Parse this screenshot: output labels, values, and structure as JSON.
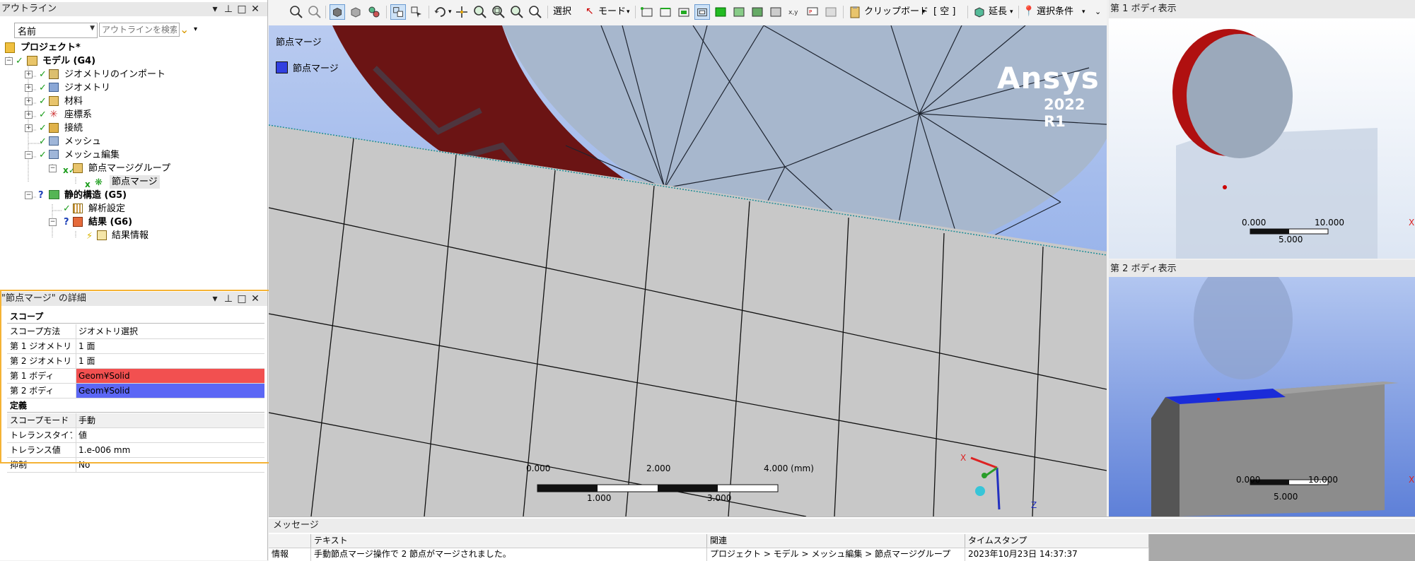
{
  "outline": {
    "title": "アウトライン",
    "filter_value": "名前",
    "search_placeholder": "アウトラインを検索",
    "tree": [
      {
        "label": "プロジェクト*",
        "bold": true
      },
      {
        "label": "モデル (G4)",
        "bold": true
      },
      {
        "label": "ジオメトリのインポート"
      },
      {
        "label": "ジオメトリ"
      },
      {
        "label": "材料"
      },
      {
        "label": "座標系"
      },
      {
        "label": "接続"
      },
      {
        "label": "メッシュ"
      },
      {
        "label": "メッシュ編集"
      },
      {
        "label": "節点マージグループ"
      },
      {
        "label": "節点マージ"
      },
      {
        "label": "静的構造 (G5)",
        "bold": true
      },
      {
        "label": "解析設定"
      },
      {
        "label": "結果 (G6)",
        "bold": true
      },
      {
        "label": "結果情報"
      }
    ]
  },
  "details": {
    "title": "\"節点マージ\" の詳細",
    "sections": {
      "scope": "スコープ",
      "definition": "定義"
    },
    "rows": [
      {
        "key": "スコープ方法",
        "value": "ジオメトリ選択"
      },
      {
        "key": "第 1 ジオメトリ",
        "value": "1 面"
      },
      {
        "key": "第 2 ジオメトリ",
        "value": "1 面"
      },
      {
        "key": "第 1 ボディ",
        "value": "Geom¥Solid"
      },
      {
        "key": "第 2 ボディ",
        "value": "Geom¥Solid"
      },
      {
        "key": "スコープモード",
        "value": "手動"
      },
      {
        "key": "トレランスタイプ",
        "value": "値"
      },
      {
        "key": "トレランス値",
        "value": "1.e-006 mm"
      },
      {
        "key": "抑制",
        "value": "No"
      }
    ],
    "colors": {
      "body1": "#f25050",
      "body2": "#5c67f5",
      "highlight_border": "#f5b335"
    }
  },
  "toolbar": {
    "select": "選択",
    "mode": "モード",
    "clipboard": "クリップボード",
    "empty": "[ 空 ]",
    "extend": "延長",
    "select_conditions": "選択条件"
  },
  "viewport": {
    "label": "節点マージ",
    "legend": "節点マージ",
    "brand": "Ansys",
    "version": "2022 R1",
    "scale_top": [
      "0.000",
      "2.000",
      "4.000 (mm)"
    ],
    "scale_bottom": [
      "1.000",
      "3.000"
    ],
    "axes": {
      "x": "X",
      "z": "Z"
    }
  },
  "body1_view": {
    "title": "第 1 ボディ表示",
    "scale_top": [
      "0.000",
      "10.000"
    ],
    "scale_bottom": "5.000",
    "axis": "X"
  },
  "body2_view": {
    "title": "第 2 ボディ表示",
    "scale_top": [
      "0.000",
      "10.000"
    ],
    "scale_bottom": "5.000",
    "axis": "X"
  },
  "messages": {
    "title": "メッセージ",
    "columns": [
      "",
      "テキスト",
      "関連",
      "タイムスタンプ"
    ],
    "rows": [
      {
        "type": "情報",
        "text": "手動節点マージ操作で 2 節点がマージされました。",
        "related": "プロジェクト > モデル > メッシュ編集 > 節点マージグループ",
        "timestamp": "2023年10月23日 14:37:37"
      }
    ]
  },
  "panel_controls": {
    "pin": "▾ ⊕ □ ✕"
  }
}
